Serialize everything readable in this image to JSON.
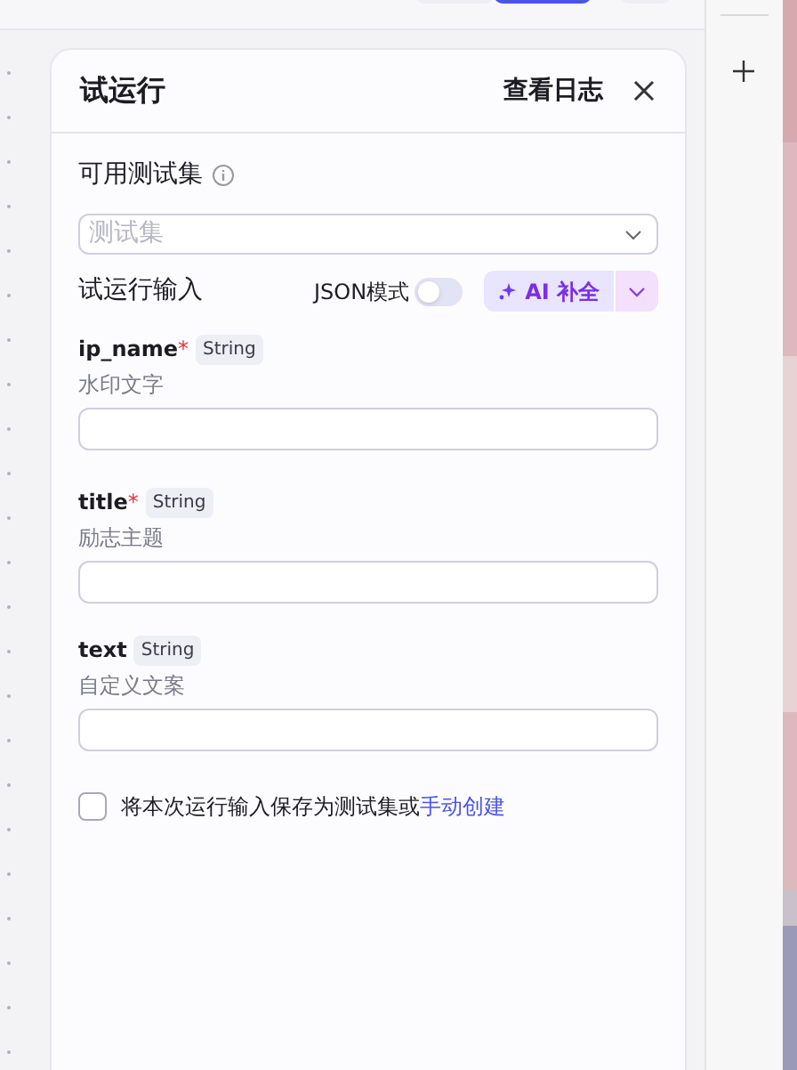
{
  "panel": {
    "title": "试运行",
    "log_link": "查看日志"
  },
  "test_set": {
    "label": "可用测试集",
    "placeholder": "测试集"
  },
  "run_input": {
    "label": "试运行输入",
    "json_mode": {
      "label": "JSON模式",
      "on": false
    },
    "ai_button": "AI 补全"
  },
  "fields": [
    {
      "name": "ip_name",
      "required_mark": "*",
      "type": "String",
      "description": "水印文字"
    },
    {
      "name": "title",
      "required_mark": "*",
      "type": "String",
      "description": "励志主题"
    },
    {
      "name": "text",
      "type": "String",
      "description": "自定义文案"
    }
  ],
  "save_option": {
    "checked": false,
    "text": "将本次运行输入保存为测试集或",
    "link": "手动创建"
  }
}
